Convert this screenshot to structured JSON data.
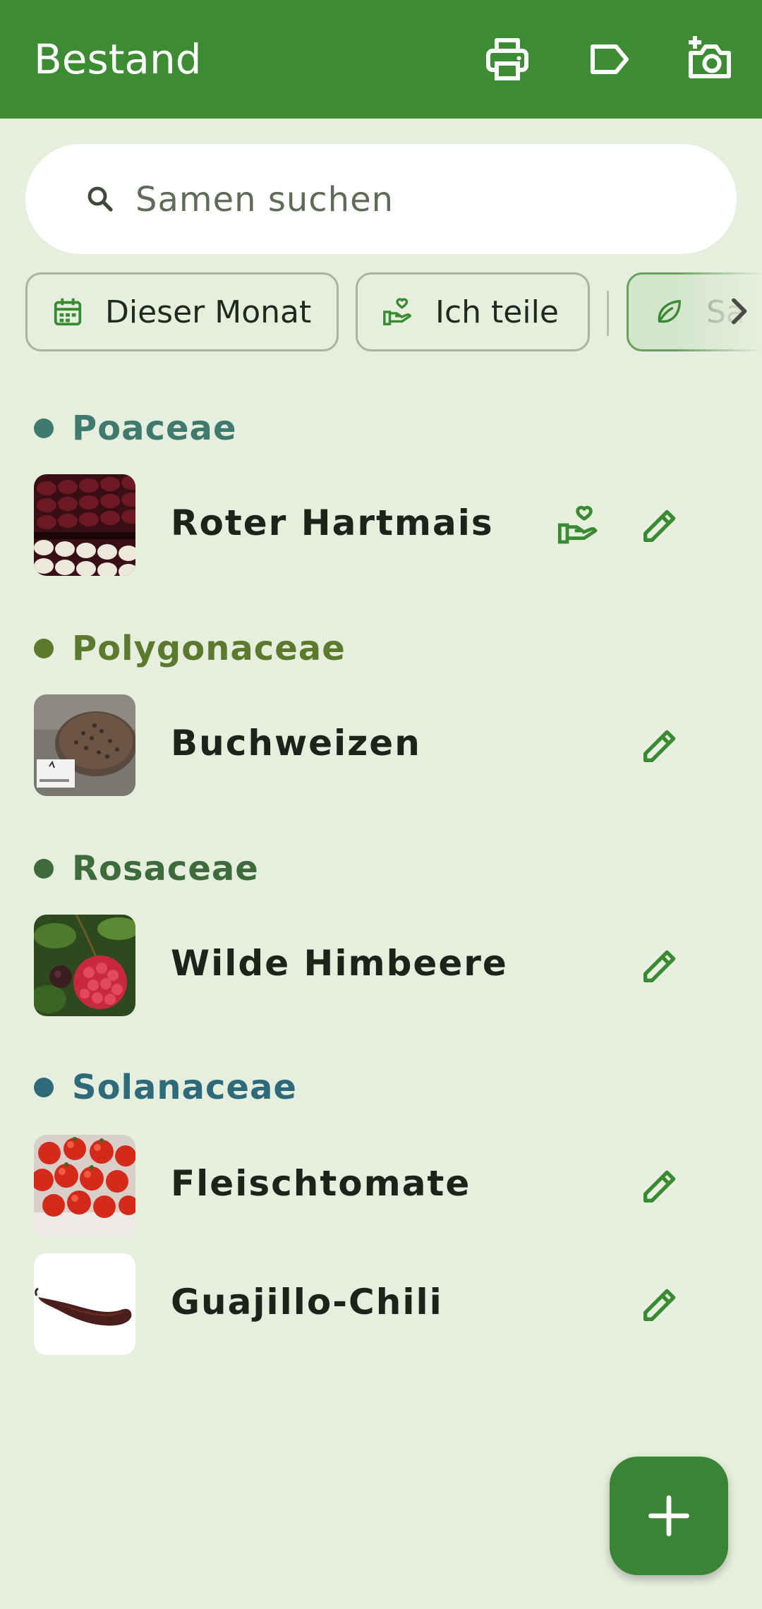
{
  "appbar": {
    "title": "Bestand",
    "actions": [
      {
        "icon": "print-icon"
      },
      {
        "icon": "label-icon"
      },
      {
        "icon": "add-photo-icon"
      }
    ]
  },
  "search": {
    "placeholder": "Samen suchen",
    "value": ""
  },
  "filters": [
    {
      "label": "Dieser Monat",
      "icon": "calendar-icon",
      "selected": false
    },
    {
      "label": "Ich teile",
      "icon": "share-heart-icon",
      "selected": false
    },
    {
      "label": "Sa",
      "icon": "leaf-icon",
      "selected": true
    }
  ],
  "groups": [
    {
      "name": "Poaceae",
      "color": "#3f7a6e",
      "items": [
        {
          "name": "Roter Hartmais",
          "shared": true,
          "thumb": "red-corn"
        }
      ]
    },
    {
      "name": "Polygonaceae",
      "color": "#5b7a2e",
      "items": [
        {
          "name": "Buchweizen",
          "shared": false,
          "thumb": "buckwheat"
        }
      ]
    },
    {
      "name": "Rosaceae",
      "color": "#3e6b3c",
      "items": [
        {
          "name": "Wilde Himbeere",
          "shared": false,
          "thumb": "raspberry"
        }
      ]
    },
    {
      "name": "Solanaceae",
      "color": "#2f6a7a",
      "items": [
        {
          "name": "Fleischtomate",
          "shared": false,
          "thumb": "tomato"
        },
        {
          "name": "Guajillo-Chili",
          "shared": false,
          "thumb": "chili"
        }
      ]
    }
  ],
  "colors": {
    "primary": "#3d8b33",
    "background": "#e6efde",
    "icon_green": "#3a8a33"
  },
  "fab": {
    "icon": "add-icon"
  }
}
